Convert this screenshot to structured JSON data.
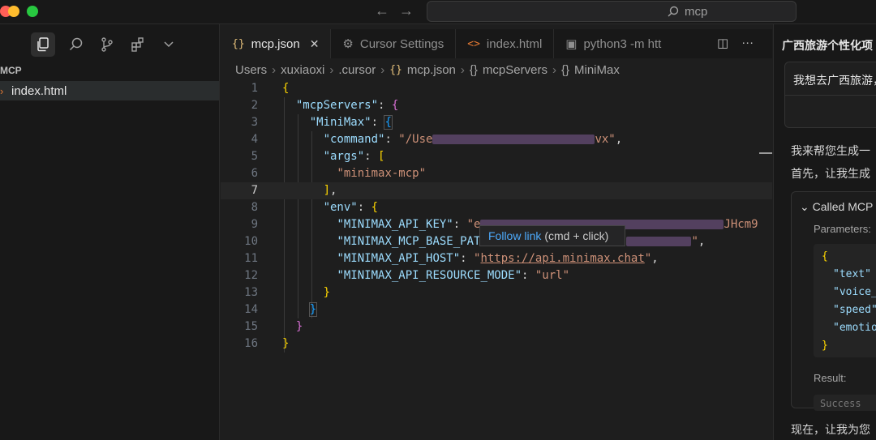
{
  "titlebar": {
    "search_text": "mcp",
    "colors": {
      "close": "#ff5f57",
      "minimize": "#febc2e",
      "zoom": "#28c840"
    }
  },
  "sidebar": {
    "section_title": "MCP",
    "files": [
      {
        "name": "index.html"
      }
    ]
  },
  "tabs": [
    {
      "icon": "{}",
      "label": "mcp.json",
      "active": true
    },
    {
      "icon": "⚙",
      "label": "Cursor Settings",
      "active": false
    },
    {
      "icon": "<>",
      "label": "index.html",
      "active": false
    },
    {
      "icon": "▣",
      "label": "python3 -m htt",
      "active": false
    }
  ],
  "breadcrumb": [
    "Users",
    "xuxiaoxi",
    ".cursor",
    "mcp.json",
    "mcpServers",
    "MiniMax"
  ],
  "editor": {
    "current_line": 7,
    "line_numbers": [
      "1",
      "2",
      "3",
      "4",
      "5",
      "6",
      "7",
      "8",
      "9",
      "10",
      "11",
      "12",
      "13",
      "14",
      "15",
      "16"
    ],
    "keys": {
      "mcpServers": "\"mcpServers\"",
      "minimax": "\"MiniMax\"",
      "command": "\"command\"",
      "args": "\"args\"",
      "env": "\"env\"",
      "api_key": "\"MINIMAX_API_KEY\"",
      "base_path": "\"MINIMAX_MCP_BASE_PAT",
      "api_host": "\"MINIMAX_API_HOST\"",
      "resource_mode": "\"MINIMAX_API_RESOURCE_MODE\""
    },
    "values": {
      "command_start": "\"/Use",
      "command_end": "vx\"",
      "arg0": "\"minimax-mcp\"",
      "api_key_start": "\"e",
      "api_key_end": "JHcm9",
      "api_host": "https://api.minimax.chat",
      "resource_mode": "\"url\""
    }
  },
  "hover": {
    "link_label": "Follow link",
    "hint": "(cmd + click)"
  },
  "chat": {
    "title": "广西旅游个性化项",
    "user_message": "我想去广西旅游，",
    "line1": "我来帮您生成一",
    "line2": "首先，让我生成",
    "mcp_card_title": "Called MCP",
    "parameters_label": "Parameters:",
    "params": [
      "{",
      "\"text\"",
      "\"voice_",
      "\"speed\"",
      "\"emotio",
      "}"
    ],
    "result_label": "Result:",
    "result_text": "Success",
    "line3": "现在，让我为您"
  }
}
